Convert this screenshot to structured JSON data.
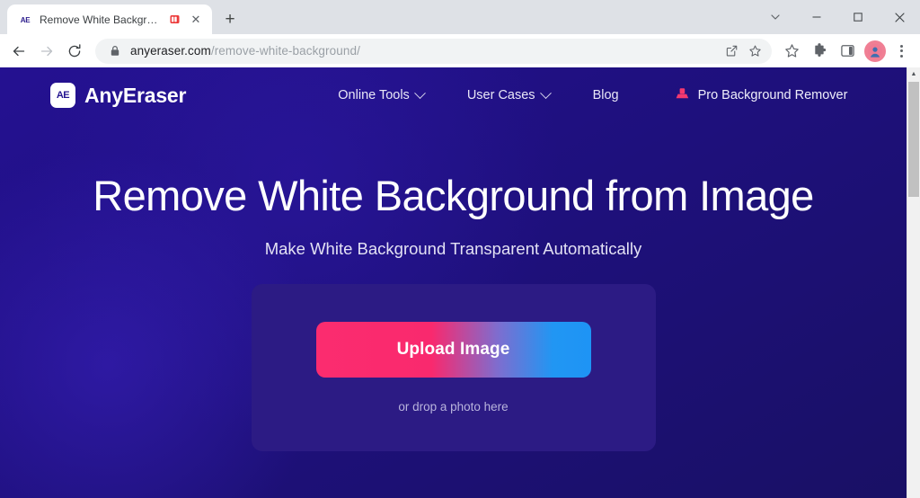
{
  "browser": {
    "tab": {
      "favicon_text": "AE",
      "favicon_icon": "anyeraser-logo-icon",
      "title": "Remove White Background",
      "badge_icon": "speaker-muted-indicator-icon",
      "close_icon": "close-icon",
      "close_glyph": "✕"
    },
    "new_tab_glyph": "+",
    "window_controls": {
      "tab_search_icon": "chevron-down-icon",
      "minimize_icon": "minimize-icon",
      "maximize_icon": "maximize-icon",
      "close_icon": "close-icon"
    },
    "toolbar": {
      "back_icon": "back-arrow-icon",
      "forward_icon": "forward-arrow-icon",
      "reload_icon": "reload-icon",
      "lock_icon": "lock-icon",
      "url_host": "anyeraser.com",
      "url_path": "/remove-white-background/",
      "url_full": "anyeraser.com/remove-white-background/",
      "share_icon": "share-icon",
      "bookmark_icon": "bookmark-star-icon",
      "favorites_icon": "star-icon",
      "extensions_icon": "puzzle-piece-icon",
      "side_panel_icon": "side-panel-icon",
      "profile_icon": "profile-avatar-icon",
      "menu_icon": "three-dots-menu-icon"
    },
    "scrollbar": {
      "up_arrow_glyph": "▲",
      "down_arrow_glyph": "▼"
    }
  },
  "site": {
    "brand": {
      "mark_text": "AE",
      "name": "AnyEraser"
    },
    "nav": [
      {
        "label": "Online Tools",
        "has_caret": true
      },
      {
        "label": "User Cases",
        "has_caret": true
      },
      {
        "label": "Blog",
        "has_caret": false
      }
    ],
    "pro_link": {
      "label": "Pro Background Remover",
      "icon": "eraser-icon",
      "icon_color": "#f4396f"
    },
    "hero": {
      "title": "Remove White Background from Image",
      "subtitle": "Make White Background Transparent Automatically",
      "upload_button": "Upload Image",
      "drop_hint": "or drop a photo here"
    },
    "colors": {
      "page_bg_dark": "#191065",
      "page_bg_mid": "#1f1080",
      "page_bg_light": "#241191",
      "dropzone_bg": "#2c1b84",
      "gradient_start": "#fb2c6f",
      "gradient_end": "#1e94f5",
      "accent_pink": "#f4396f"
    }
  }
}
